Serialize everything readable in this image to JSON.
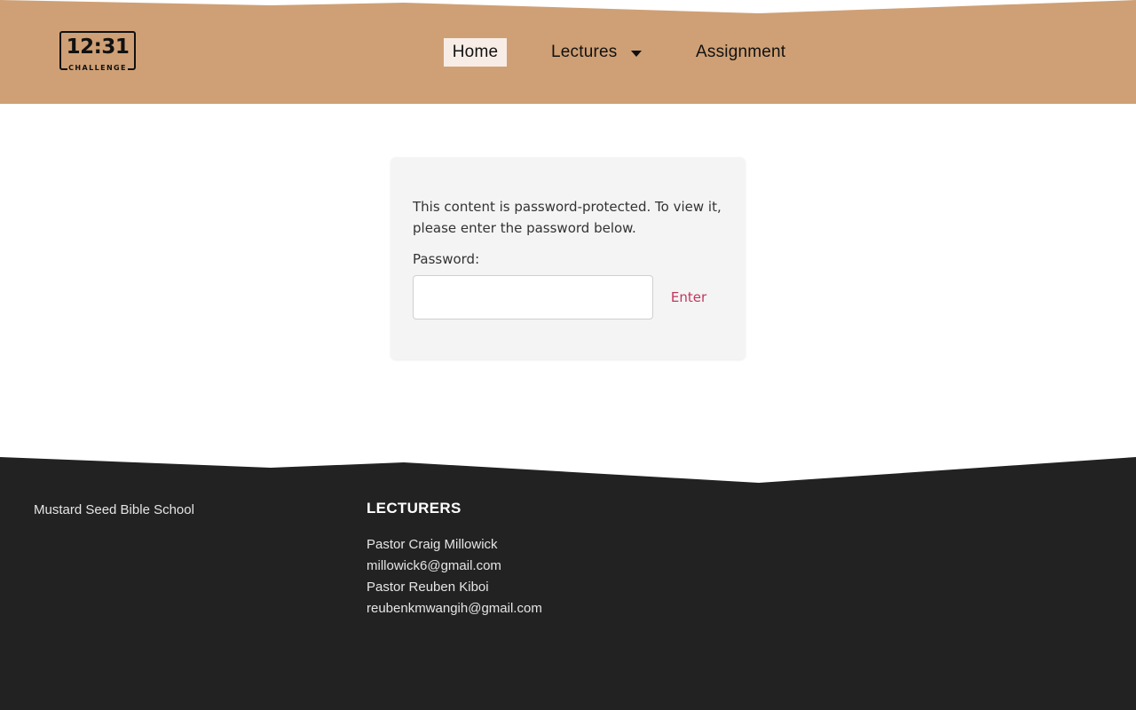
{
  "colors": {
    "header_background": "#cfa075",
    "footer_background": "#222222",
    "nav_active_background": "#f8ede6",
    "enter_button_text": "#c0365c",
    "panel_background": "#f4f4f4"
  },
  "header": {
    "logo": {
      "time_text": "12:31",
      "word_text": "CHALLENGE"
    },
    "nav": [
      {
        "label": "Home",
        "active": true
      },
      {
        "label": "Lectures",
        "has_dropdown": true,
        "icon": "caret-down-icon"
      },
      {
        "label": "Assignment"
      }
    ]
  },
  "password_form": {
    "message": "This content is password-protected. To view it, please enter the password below.",
    "label": "Password:",
    "input_value": "",
    "button_label": "Enter"
  },
  "footer": {
    "brand": "Mustard Seed Bible School",
    "lecturers_heading": "LECTURERS",
    "lecturers": [
      {
        "name": "Pastor Craig Millowick",
        "email": "millowick6@gmail.com"
      },
      {
        "name": "Pastor Reuben Kiboi",
        "email": "reubenkmwangih@gmail.com"
      }
    ]
  }
}
